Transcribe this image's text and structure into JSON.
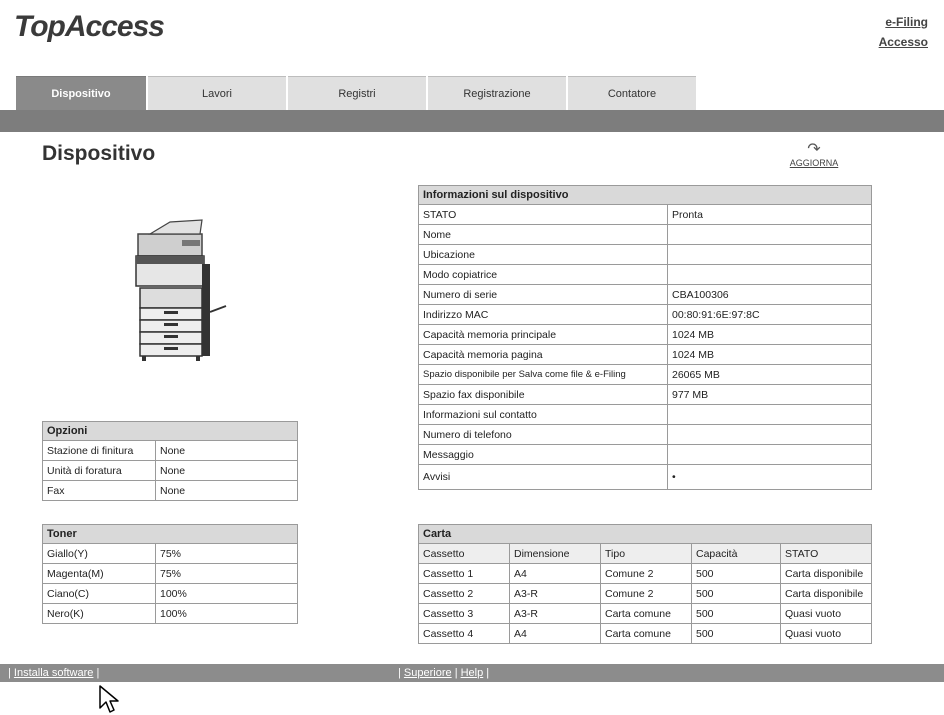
{
  "header": {
    "logo": "TopAccess",
    "links": [
      "e-Filing",
      "Accesso"
    ]
  },
  "tabs": [
    {
      "label": "Dispositivo",
      "active": true
    },
    {
      "label": "Lavori",
      "active": false
    },
    {
      "label": "Registri",
      "active": false
    },
    {
      "label": "Registrazione",
      "active": false
    },
    {
      "label": "Contatore",
      "active": false
    }
  ],
  "page": {
    "title": "Dispositivo",
    "refresh_label": "AGGIORNA",
    "refresh_icon": "refresh-icon"
  },
  "options": {
    "title": "Opzioni",
    "rows": [
      [
        "Stazione di finitura",
        "None"
      ],
      [
        "Unità di foratura",
        "None"
      ],
      [
        "Fax",
        "None"
      ]
    ]
  },
  "toner": {
    "title": "Toner",
    "rows": [
      [
        "Giallo(Y)",
        "75%"
      ],
      [
        "Magenta(M)",
        "75%"
      ],
      [
        "Ciano(C)",
        "100%"
      ],
      [
        "Nero(K)",
        "100%"
      ]
    ]
  },
  "device_info": {
    "title": "Informazioni sul dispositivo",
    "rows": [
      [
        "STATO",
        "Pronta"
      ],
      [
        "Nome",
        ""
      ],
      [
        "Ubicazione",
        ""
      ],
      [
        "Modo copiatrice",
        ""
      ],
      [
        "Numero di serie",
        "CBA100306"
      ],
      [
        "Indirizzo MAC",
        "00:80:91:6E:97:8C"
      ],
      [
        "Capacità memoria principale",
        "1024 MB"
      ],
      [
        "Capacità memoria pagina",
        "1024 MB"
      ],
      [
        "Spazio disponibile per Salva come file & e-Filing",
        "26065 MB"
      ],
      [
        "Spazio fax disponibile",
        "977 MB"
      ],
      [
        "Informazioni sul contatto",
        ""
      ],
      [
        "Numero di telefono",
        ""
      ],
      [
        "Messaggio",
        ""
      ],
      [
        "Avvisi",
        "•"
      ]
    ]
  },
  "paper": {
    "title": "Carta",
    "columns": [
      "Cassetto",
      "Dimensione",
      "Tipo",
      "Capacità",
      "STATO"
    ],
    "rows": [
      [
        "Cassetto 1",
        "A4",
        "Comune 2",
        "500",
        "Carta disponibile"
      ],
      [
        "Cassetto 2",
        "A3-R",
        "Comune 2",
        "500",
        "Carta disponibile"
      ],
      [
        "Cassetto 3",
        "A3-R",
        "Carta comune",
        "500",
        "Quasi vuoto"
      ],
      [
        "Cassetto 4",
        "A4",
        "Carta comune",
        "500",
        "Quasi vuoto"
      ]
    ]
  },
  "footer": {
    "install": "Installa software",
    "top": "Superiore",
    "help": "Help",
    "sep": "|"
  }
}
